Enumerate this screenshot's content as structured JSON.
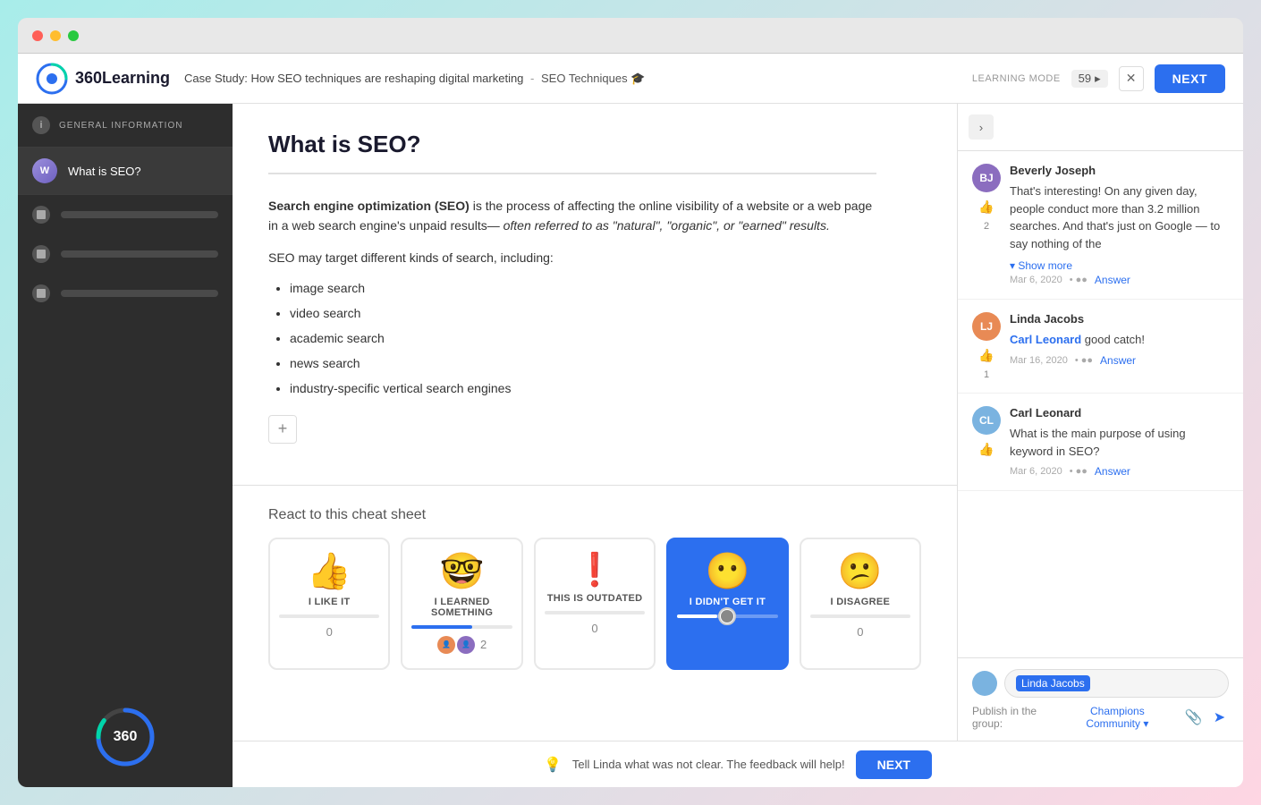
{
  "window": {
    "dots": [
      "red",
      "yellow",
      "green"
    ]
  },
  "header": {
    "logo_text": "360Learning",
    "course_title": "Case Study: How SEO techniques are reshaping digital marketing",
    "separator": " - ",
    "course_link": "SEO Techniques 🎓",
    "learning_mode_label": "LEARNING MODE",
    "counter": "59",
    "counter_icon": "▸",
    "next_button": "NEXT"
  },
  "sidebar": {
    "info_label": "GENERAL INFORMATION",
    "active_item": "What is SEO?",
    "items": [
      {
        "id": "general-info",
        "label": "GENERAL INFORMATION",
        "type": "info"
      },
      {
        "id": "what-is-seo",
        "label": "What is SEO?",
        "type": "page",
        "active": true
      },
      {
        "id": "item2",
        "label": "",
        "type": "doc"
      },
      {
        "id": "item3",
        "label": "",
        "type": "doc"
      },
      {
        "id": "item4",
        "label": "",
        "type": "doc"
      }
    ],
    "progress": {
      "value": 360,
      "percent": 75,
      "label": "360"
    }
  },
  "content": {
    "title": "What is SEO?",
    "paragraph1_prefix": "Search engine optimization",
    "paragraph1_abbr": "(SEO)",
    "paragraph1_rest": " is the process of affecting the online visibility of a website or a web page in a web search engine's unpaid results—",
    "paragraph1_italic": " often referred to as \"natural\", \"organic\", or \"earned\" results.",
    "target_intro": "SEO may target different kinds of search, including:",
    "bullet_items": [
      "image search",
      "video search",
      "academic search",
      "news search",
      "industry-specific vertical search engines"
    ],
    "add_btn_label": "+"
  },
  "reactions": {
    "section_title": "React to this cheat sheet",
    "cards": [
      {
        "id": "like",
        "emoji": "👍",
        "label": "I LIKE IT",
        "count": "0",
        "bar_percent": 0,
        "selected": false,
        "users": []
      },
      {
        "id": "learned",
        "emoji": "🤓",
        "label": "I LEARNED SOMETHING",
        "count": "2",
        "bar_percent": 60,
        "selected": false,
        "users": [
          "👥",
          "2"
        ]
      },
      {
        "id": "outdated",
        "emoji": "❗",
        "label": "THIS IS OUTDATED",
        "count": "0",
        "bar_percent": 0,
        "selected": false,
        "users": []
      },
      {
        "id": "didnt-get",
        "emoji": "😶",
        "label": "I DIDN'T GET IT",
        "count": "",
        "bar_percent": 40,
        "selected": true,
        "users": []
      },
      {
        "id": "disagree",
        "emoji": "😕",
        "label": "I DISAGREE",
        "count": "0",
        "bar_percent": 0,
        "selected": false,
        "users": []
      }
    ]
  },
  "comments": {
    "items": [
      {
        "id": "bj",
        "author": "Beverly Joseph",
        "avatar_initials": "BJ",
        "avatar_class": "av-bj",
        "body": "That's interesting!  On any given day, people conduct more than 3.2 million searches. And that's just on Google — to say nothing of the",
        "show_more": "▾ Show more",
        "date": "Mar 6, 2020",
        "dots": "••",
        "likes": "2",
        "answer": "Answer"
      },
      {
        "id": "lj",
        "author": "Linda Jacobs",
        "avatar_initials": "LJ",
        "avatar_class": "av-lj",
        "body_prefix": "Carl Leonard",
        "body_text": " good catch!",
        "date": "Mar 16, 2020",
        "dots": "••",
        "likes": "1",
        "answer": "Answer"
      },
      {
        "id": "cl",
        "author": "Carl Leonard",
        "avatar_initials": "CL",
        "avatar_class": "av-cl",
        "body": "What is the main purpose of using keyword in SEO?",
        "date": "Mar 6, 2020",
        "dots": "••",
        "likes": "",
        "answer": "Answer"
      }
    ]
  },
  "comment_input": {
    "mention": "Linda Jacobs",
    "publish_label": "Publish in the group:",
    "group": "Champions Community",
    "dropdown_icon": "▾"
  },
  "feedback_bar": {
    "emoji": "💡",
    "text": "Tell Linda what was not clear. The feedback will help!",
    "next_button": "NEXT"
  }
}
